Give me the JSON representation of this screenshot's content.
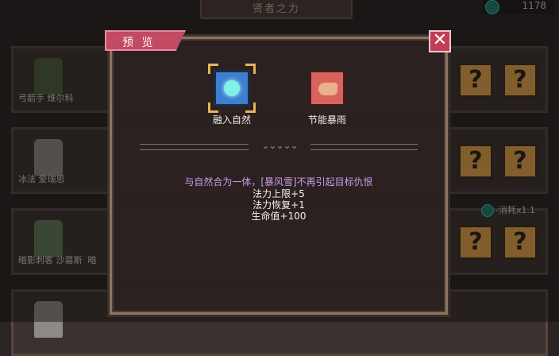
{
  "header": {
    "title": "贤者之力",
    "currency_amount": "1178"
  },
  "heroes": [
    {
      "name": "弓箭手 维尔科"
    },
    {
      "name": "冰法 爱瑞思"
    },
    {
      "name": "暗影刺客 沙葛斯",
      "extra": "暗"
    },
    {
      "name": ""
    }
  ],
  "cost_badge": "-消耗x1.1",
  "slot_glyph": "?",
  "dialog": {
    "tab_label": "预 览",
    "close_glyph": "✕",
    "divider_ornament": "⌄⌄⌄⌄⌄",
    "skills": [
      {
        "label": "融入自然",
        "icon": "nature-orb-icon",
        "selected": true
      },
      {
        "label": "节能暴雨",
        "icon": "flexed-arm-icon",
        "selected": false
      }
    ],
    "description": "与自然合为一体，[暴风雪]不再引起目标仇恨",
    "stats": [
      "法力上限+5",
      "法力恢复+1",
      "生命值+100"
    ]
  },
  "colors": {
    "accent_tab": "#c24a63",
    "description_text": "#c99de8",
    "slot_gold": "#e2a44a"
  }
}
